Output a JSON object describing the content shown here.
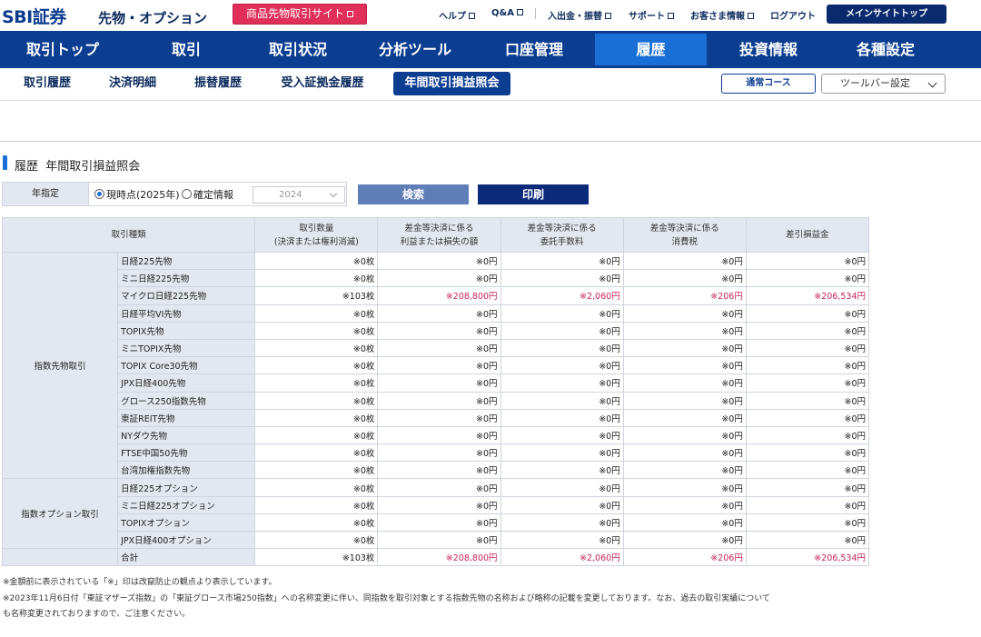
{
  "header": {
    "logo": "SBI証券",
    "section": "先物・オプション",
    "commodity_button": "商品先物取引サイト",
    "links": [
      "ヘルプ",
      "Q&A",
      "入出金・振替",
      "サポート",
      "お客さま情報",
      "ログアウト"
    ],
    "main_site_button": "メインサイトトップ"
  },
  "nav": {
    "items": [
      "取引トップ",
      "取引",
      "取引状況",
      "分析ツール",
      "口座管理",
      "履歴",
      "投資情報",
      "各種設定"
    ],
    "active": "履歴"
  },
  "subnav": {
    "items": [
      "取引履歴",
      "決済明細",
      "振替履歴",
      "受入証拠金履歴",
      "年間取引損益照会"
    ],
    "active": "年間取引損益照会",
    "course_button": "通常コース",
    "toolbar_select": "ツールバー設定"
  },
  "page": {
    "title": "履歴  年間取引損益照会"
  },
  "filter": {
    "label": "年指定",
    "option_current": "現時点(2025年)",
    "option_confirmed": "確定情報",
    "year": "2024",
    "search_button": "検索",
    "print_button": "印刷"
  },
  "table": {
    "headers": {
      "type": "取引種類",
      "qty_1": "取引数量",
      "qty_2": "(決済または権利消滅)",
      "pl_1": "差金等決済に係る",
      "pl_2": "利益または損失の額",
      "fee_1": "差金等決済に係る",
      "fee_2": "委託手数料",
      "tax_1": "差金等決済に係る",
      "tax_2": "消費税",
      "net": "差引損益金"
    },
    "categories": {
      "futures": "指数先物取引",
      "options": "指数オプション取引"
    },
    "rows": [
      {
        "name": "日経225先物",
        "qty": "※0枚",
        "pl": "※0円",
        "fee": "※0円",
        "tax": "※0円",
        "net": "※0円",
        "hl": false
      },
      {
        "name": "ミニ日経225先物",
        "qty": "※0枚",
        "pl": "※0円",
        "fee": "※0円",
        "tax": "※0円",
        "net": "※0円",
        "hl": false
      },
      {
        "name": "マイクロ日経225先物",
        "qty": "※103枚",
        "pl": "※208,800円",
        "fee": "※2,060円",
        "tax": "※206円",
        "net": "※206,534円",
        "hl": true
      },
      {
        "name": "日経平均VI先物",
        "qty": "※0枚",
        "pl": "※0円",
        "fee": "※0円",
        "tax": "※0円",
        "net": "※0円",
        "hl": false
      },
      {
        "name": "TOPIX先物",
        "qty": "※0枚",
        "pl": "※0円",
        "fee": "※0円",
        "tax": "※0円",
        "net": "※0円",
        "hl": false
      },
      {
        "name": "ミニTOPIX先物",
        "qty": "※0枚",
        "pl": "※0円",
        "fee": "※0円",
        "tax": "※0円",
        "net": "※0円",
        "hl": false
      },
      {
        "name": "TOPIX Core30先物",
        "qty": "※0枚",
        "pl": "※0円",
        "fee": "※0円",
        "tax": "※0円",
        "net": "※0円",
        "hl": false
      },
      {
        "name": "JPX日経400先物",
        "qty": "※0枚",
        "pl": "※0円",
        "fee": "※0円",
        "tax": "※0円",
        "net": "※0円",
        "hl": false
      },
      {
        "name": "グロース250指数先物",
        "qty": "※0枚",
        "pl": "※0円",
        "fee": "※0円",
        "tax": "※0円",
        "net": "※0円",
        "hl": false
      },
      {
        "name": "東証REIT先物",
        "qty": "※0枚",
        "pl": "※0円",
        "fee": "※0円",
        "tax": "※0円",
        "net": "※0円",
        "hl": false
      },
      {
        "name": "NYダウ先物",
        "qty": "※0枚",
        "pl": "※0円",
        "fee": "※0円",
        "tax": "※0円",
        "net": "※0円",
        "hl": false
      },
      {
        "name": "FTSE中国50先物",
        "qty": "※0枚",
        "pl": "※0円",
        "fee": "※0円",
        "tax": "※0円",
        "net": "※0円",
        "hl": false
      },
      {
        "name": "台湾加権指数先物",
        "qty": "※0枚",
        "pl": "※0円",
        "fee": "※0円",
        "tax": "※0円",
        "net": "※0円",
        "hl": false
      },
      {
        "name": "日経225オプション",
        "qty": "※0枚",
        "pl": "※0円",
        "fee": "※0円",
        "tax": "※0円",
        "net": "※0円",
        "hl": false
      },
      {
        "name": "ミニ日経225オプション",
        "qty": "※0枚",
        "pl": "※0円",
        "fee": "※0円",
        "tax": "※0円",
        "net": "※0円",
        "hl": false
      },
      {
        "name": "TOPIXオプション",
        "qty": "※0枚",
        "pl": "※0円",
        "fee": "※0円",
        "tax": "※0円",
        "net": "※0円",
        "hl": false
      },
      {
        "name": "JPX日経400オプション",
        "qty": "※0枚",
        "pl": "※0円",
        "fee": "※0円",
        "tax": "※0円",
        "net": "※0円",
        "hl": false
      }
    ],
    "total": {
      "name": "合計",
      "qty": "※103枚",
      "pl": "※208,800円",
      "fee": "※2,060円",
      "tax": "※206円",
      "net": "※206,534円"
    }
  },
  "notes": [
    "※金額前に表示されている「※」印は改竄防止の観点より表示しています。",
    "※2023年11月6日付「東証マザーズ指数」の「東証グロース市場250指数」への名称変更に伴い、同指数を取引対象とする指数先物の名称および略称の記載を変更しております。なお、過去の取引実績について",
    "も名称変更されておりますので、ご注意ください。"
  ],
  "colors": {
    "brand_navy": "#0b3d91",
    "active_blue": "#1a6fd6",
    "commodity_pink": "#e0305a",
    "profit_red": "#c8245a"
  }
}
